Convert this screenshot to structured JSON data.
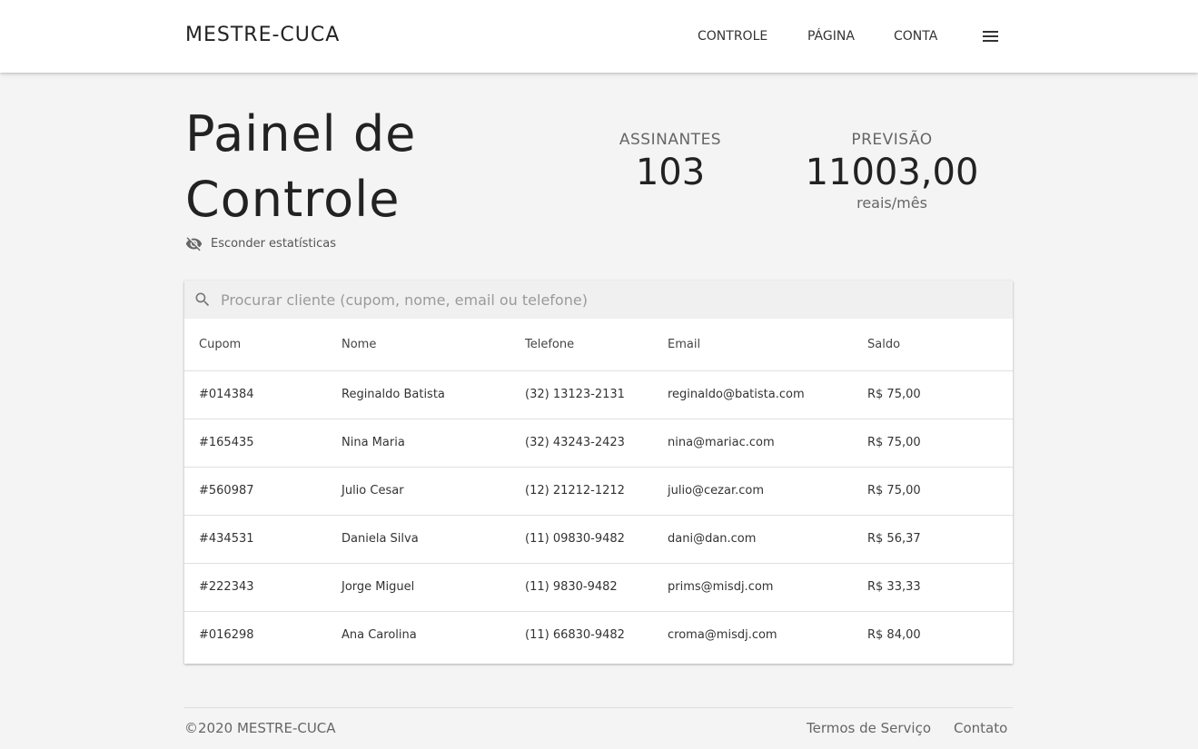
{
  "header": {
    "brand": "MESTRE-CUCA",
    "nav": [
      "CONTROLE",
      "PÁGINA",
      "CONTA"
    ],
    "menu_icon": "hamburger-menu-icon"
  },
  "main": {
    "title": "Painel de Controle",
    "hide_stats_icon": "visibility-off-icon",
    "hide_stats_label": "Esconder estatísticas",
    "stats": {
      "assinantes": {
        "label": "ASSINANTES",
        "value": "103"
      },
      "previsao": {
        "label": "PREVISÃO",
        "value": "11003,00",
        "unit": "reais/mês"
      }
    },
    "search": {
      "icon": "search-icon",
      "placeholder": "Procurar cliente (cupom, nome, email ou telefone)",
      "value": ""
    },
    "table": {
      "columns": [
        "Cupom",
        "Nome",
        "Telefone",
        "Email",
        "Saldo"
      ],
      "rows": [
        [
          "#014384",
          "Reginaldo Batista",
          "(32) 13123-2131",
          "reginaldo@batista.com",
          "R$ 75,00"
        ],
        [
          "#165435",
          "Nina Maria",
          "(32) 43243-2423",
          "nina@mariac.com",
          "R$ 75,00"
        ],
        [
          "#560987",
          "Julio Cesar",
          "(12) 21212-1212",
          "julio@cezar.com",
          "R$ 75,00"
        ],
        [
          "#434531",
          "Daniela Silva",
          "(11) 09830-9482",
          "dani@dan.com",
          "R$ 56,37"
        ],
        [
          "#222343",
          "Jorge Miguel",
          "(11) 9830-9482",
          "prims@misdj.com",
          "R$ 33,33"
        ],
        [
          "#016298",
          "Ana Carolina",
          "(11) 66830-9482",
          "croma@misdj.com",
          "R$ 84,00"
        ]
      ]
    }
  },
  "footer": {
    "copyright": "©2020 MESTRE-CUCA",
    "links": [
      "Termos de Serviço",
      "Contato"
    ]
  }
}
